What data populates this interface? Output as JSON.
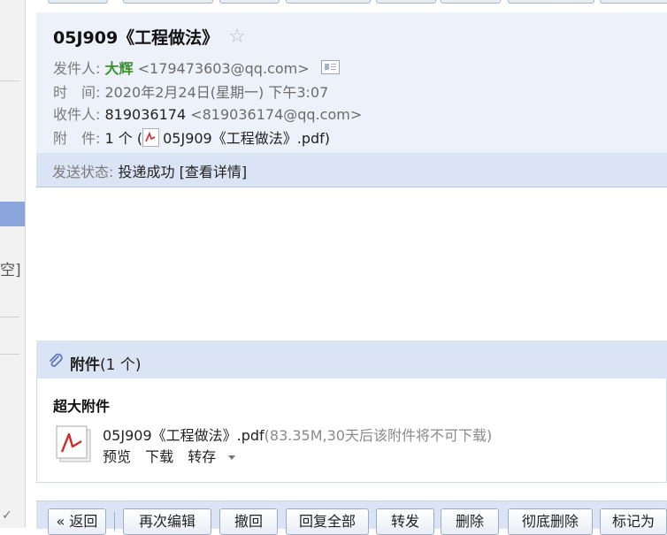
{
  "sidebar": {
    "partial_text": "空]",
    "partial_mark": "✓"
  },
  "email": {
    "subject": "05J909《工程做法》",
    "from": {
      "label": "发件人:",
      "name": "大辉",
      "address": "<179473603@qq.com>"
    },
    "time": {
      "label": "时　间:",
      "value": "2020年2月24日(星期一) 下午3:07"
    },
    "to": {
      "label": "收件人:",
      "name": "819036174",
      "address": "<819036174@qq.com>"
    },
    "attachments_row": {
      "label": "附　件:",
      "count": "1 个 (",
      "file": "05J909《工程做法》.pdf",
      "close": ")"
    },
    "status": {
      "label": "发送状态:",
      "value": "投递成功",
      "link": "[查看详情]"
    }
  },
  "attachments": {
    "title": "附件",
    "count": "(1 个)",
    "type_label": "超大附件",
    "file_name": "05J909《工程做法》.pdf",
    "file_info": "(83.35M,30天后该附件将不可下载)",
    "actions": {
      "preview": "预览",
      "download": "下载",
      "save": "转存"
    }
  },
  "toolbar": {
    "buttons": [
      "« 返回",
      "再次编辑",
      "撤回",
      "回复全部",
      "转发",
      "删除",
      "彻底删除",
      "标记为"
    ]
  },
  "colors": {
    "accent_bg": "#dbe4f4",
    "header_bg": "#edf1f9",
    "sender": "#3d8f2f"
  }
}
